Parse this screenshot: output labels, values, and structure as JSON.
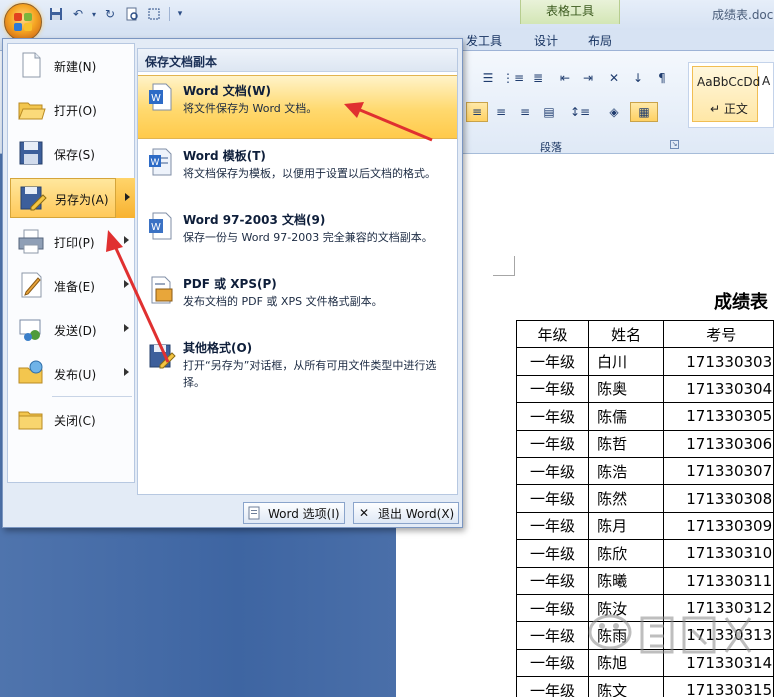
{
  "window": {
    "title": "成绩表.doc",
    "context_tab_group": "表格工具"
  },
  "ribbon": {
    "tabs": [
      "发工具",
      "设计",
      "布局"
    ],
    "group_label": "段落",
    "styles": {
      "normal_sample": "AaBbCcDd",
      "normal_name": "↵ 正文",
      "next_sample": "A"
    }
  },
  "office_menu": {
    "items": [
      {
        "label": "新建(N)",
        "icon": "new-document-icon",
        "has_submenu": false
      },
      {
        "label": "打开(O)",
        "icon": "open-folder-icon",
        "has_submenu": false
      },
      {
        "label": "保存(S)",
        "icon": "save-disk-icon",
        "has_submenu": false
      },
      {
        "label": "另存为(A)",
        "icon": "save-as-icon",
        "has_submenu": true,
        "active": true
      },
      {
        "label": "打印(P)",
        "icon": "printer-icon",
        "has_submenu": true
      },
      {
        "label": "准备(E)",
        "icon": "prepare-icon",
        "has_submenu": true
      },
      {
        "label": "发送(D)",
        "icon": "send-icon",
        "has_submenu": true
      },
      {
        "label": "发布(U)",
        "icon": "publish-icon",
        "has_submenu": true
      },
      {
        "label": "关闭(C)",
        "icon": "close-folder-icon",
        "has_submenu": false
      }
    ],
    "submenu": {
      "header": "保存文档副本",
      "items": [
        {
          "title": "Word 文档(W)",
          "desc": "将文件保存为 Word 文档。",
          "icon": "word-document-icon",
          "active": true
        },
        {
          "title": "Word 模板(T)",
          "desc": "将文档保存为模板，以便用于设置以后文档的格式。",
          "icon": "word-template-icon"
        },
        {
          "title": "Word 97-2003 文档(9)",
          "desc": "保存一份与 Word 97-2003 完全兼容的文档副本。",
          "icon": "word-97-icon"
        },
        {
          "title": "PDF 或 XPS(P)",
          "desc": "发布文档的 PDF 或 XPS 文件格式副本。",
          "icon": "pdf-xps-icon"
        },
        {
          "title": "其他格式(O)",
          "desc": "打开“另存为”对话框，从所有可用文件类型中进行选择。",
          "icon": "other-formats-icon"
        }
      ]
    },
    "footer": {
      "options_label": "Word 选项(I)",
      "exit_label": "退出 Word(X)"
    }
  },
  "document": {
    "title": "成绩表",
    "table": {
      "headers": [
        "年级",
        "姓名",
        "考号"
      ],
      "rows": [
        [
          "一年级",
          "白川",
          "171330303"
        ],
        [
          "一年级",
          "陈奥",
          "171330304"
        ],
        [
          "一年级",
          "陈儒",
          "171330305"
        ],
        [
          "一年级",
          "陈哲",
          "171330306"
        ],
        [
          "一年级",
          "陈浩",
          "171330307"
        ],
        [
          "一年级",
          "陈然",
          "171330308"
        ],
        [
          "一年级",
          "陈月",
          "171330309"
        ],
        [
          "一年级",
          "陈欣",
          "171330310"
        ],
        [
          "一年级",
          "陈曦",
          "171330311"
        ],
        [
          "一年级",
          "陈汝",
          "171330312"
        ],
        [
          "一年级",
          "陈雨",
          "171330313"
        ],
        [
          "一年级",
          "陈旭",
          "171330314"
        ],
        [
          "一年级",
          "陈文",
          "171330315"
        ]
      ]
    }
  },
  "colors": {
    "annotation_arrow": "#e03030",
    "menu_highlight": "#ffd163",
    "office_button": "#f6a623"
  }
}
